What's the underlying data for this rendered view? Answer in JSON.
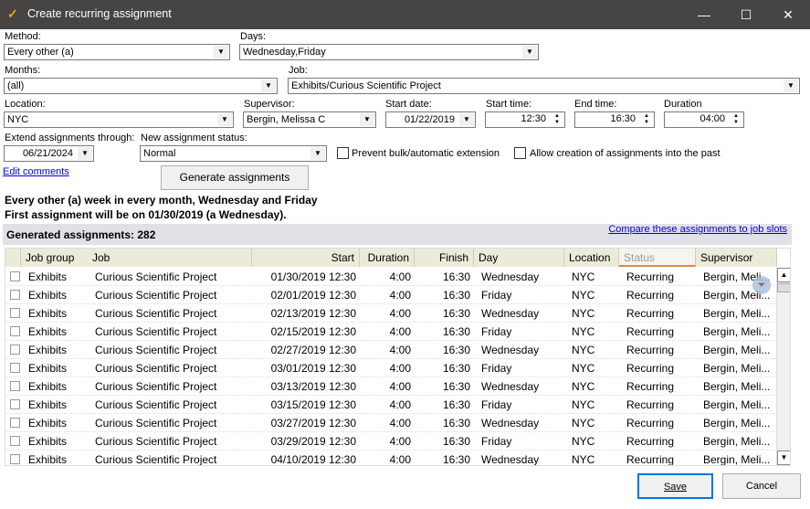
{
  "window": {
    "title": "Create recurring assignment",
    "minimize": "—",
    "maximize": "☐",
    "close": "✕"
  },
  "form": {
    "method_label": "Method:",
    "method": "Every other (a)",
    "days_label": "Days:",
    "days": "Wednesday,Friday",
    "months_label": "Months:",
    "months": "(all)",
    "job_label": "Job:",
    "job": "Exhibits/Curious Scientific Project",
    "location_label": "Location:",
    "location": "NYC",
    "supervisor_label": "Supervisor:",
    "supervisor": "Bergin, Melissa C",
    "start_date_label": "Start date:",
    "start_date": "01/22/2019",
    "start_time_label": "Start time:",
    "start_time": "12:30",
    "end_time_label": "End time:",
    "end_time": "16:30",
    "duration_label": "Duration:",
    "duration": "04:00",
    "extend_label": "Extend assignments through:",
    "extend": "06/21/2024",
    "status_label": "New assignment status:",
    "status": "Normal",
    "prevent_label": "Prevent bulk/automatic extension",
    "prevent_checked": false,
    "allow_past_label": "Allow creation of assignments into the past",
    "allow_past_checked": false,
    "edit_comments": "Edit comments",
    "generate": "Generate assignments"
  },
  "summary": {
    "line1": "Every other (a) week in every month, Wednesday and Friday",
    "line2": "First assignment will be on 01/30/2019 (a Wednesday).",
    "count_text": "Generated assignments: 282",
    "compare_link": "Compare these assignments to job slots"
  },
  "grid": {
    "columns": [
      "Job group",
      "Job",
      "Start",
      "Duration",
      "Finish",
      "Day",
      "Location",
      "Status",
      "Supervisor"
    ],
    "rows": [
      [
        "Exhibits",
        "Curious Scientific Project",
        "01/30/2019 12:30",
        "4:00",
        "16:30",
        "Wednesday",
        "NYC",
        "Recurring",
        "Bergin, Meli..."
      ],
      [
        "Exhibits",
        "Curious Scientific Project",
        "02/01/2019 12:30",
        "4:00",
        "16:30",
        "Friday",
        "NYC",
        "Recurring",
        "Bergin, Meli..."
      ],
      [
        "Exhibits",
        "Curious Scientific Project",
        "02/13/2019 12:30",
        "4:00",
        "16:30",
        "Wednesday",
        "NYC",
        "Recurring",
        "Bergin, Meli..."
      ],
      [
        "Exhibits",
        "Curious Scientific Project",
        "02/15/2019 12:30",
        "4:00",
        "16:30",
        "Friday",
        "NYC",
        "Recurring",
        "Bergin, Meli..."
      ],
      [
        "Exhibits",
        "Curious Scientific Project",
        "02/27/2019 12:30",
        "4:00",
        "16:30",
        "Wednesday",
        "NYC",
        "Recurring",
        "Bergin, Meli..."
      ],
      [
        "Exhibits",
        "Curious Scientific Project",
        "03/01/2019 12:30",
        "4:00",
        "16:30",
        "Friday",
        "NYC",
        "Recurring",
        "Bergin, Meli..."
      ],
      [
        "Exhibits",
        "Curious Scientific Project",
        "03/13/2019 12:30",
        "4:00",
        "16:30",
        "Wednesday",
        "NYC",
        "Recurring",
        "Bergin, Meli..."
      ],
      [
        "Exhibits",
        "Curious Scientific Project",
        "03/15/2019 12:30",
        "4:00",
        "16:30",
        "Friday",
        "NYC",
        "Recurring",
        "Bergin, Meli..."
      ],
      [
        "Exhibits",
        "Curious Scientific Project",
        "03/27/2019 12:30",
        "4:00",
        "16:30",
        "Wednesday",
        "NYC",
        "Recurring",
        "Bergin, Meli..."
      ],
      [
        "Exhibits",
        "Curious Scientific Project",
        "03/29/2019 12:30",
        "4:00",
        "16:30",
        "Friday",
        "NYC",
        "Recurring",
        "Bergin, Meli..."
      ],
      [
        "Exhibits",
        "Curious Scientific Project",
        "04/10/2019 12:30",
        "4:00",
        "16:30",
        "Wednesday",
        "NYC",
        "Recurring",
        "Bergin, Meli..."
      ]
    ]
  },
  "footer": {
    "save": "Save",
    "cancel": "Cancel"
  }
}
